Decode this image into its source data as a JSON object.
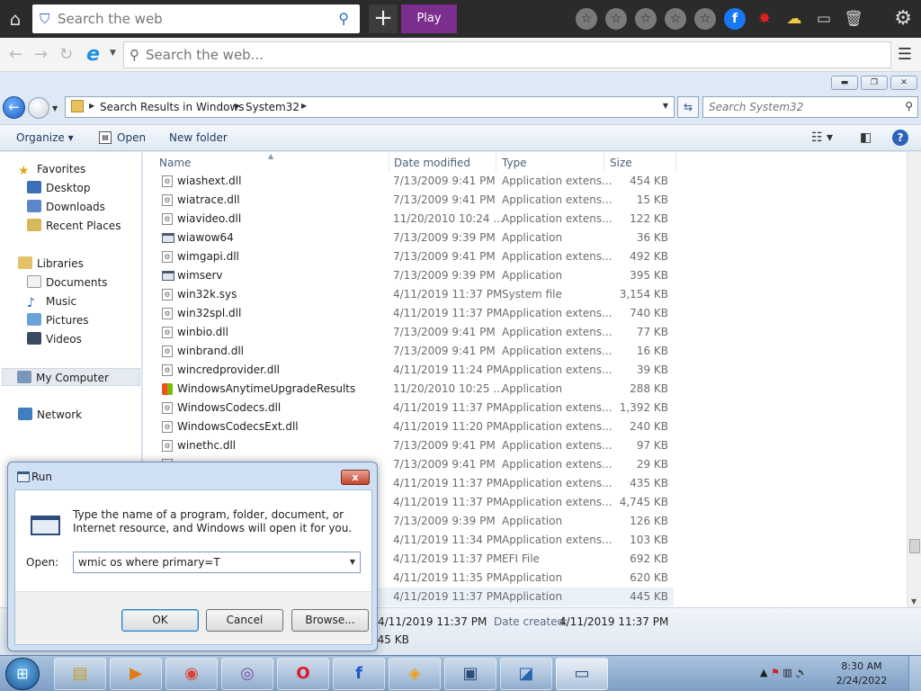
{
  "topbar": {
    "search_placeholder": "Search the web",
    "play_label": "Play",
    "plus_label": "+"
  },
  "iebar": {
    "search_placeholder": "Search the web..."
  },
  "explorer": {
    "breadcrumbs": [
      "Search Results in Windows",
      "System32"
    ],
    "search_placeholder": "Search System32",
    "commands": {
      "organize": "Organize",
      "open": "Open",
      "new_folder": "New folder"
    },
    "nav": {
      "favorites": "Favorites",
      "desktop": "Desktop",
      "downloads": "Downloads",
      "recent_places": "Recent Places",
      "libraries": "Libraries",
      "documents": "Documents",
      "music": "Music",
      "pictures": "Pictures",
      "videos": "Videos",
      "my_computer": "My Computer",
      "network": "Network"
    },
    "columns": {
      "name": "Name",
      "date": "Date modified",
      "type": "Type",
      "size": "Size"
    },
    "files": [
      {
        "name": "wiashext.dll",
        "date": "7/13/2009 9:41 PM",
        "type": "Application extens...",
        "size": "454 KB"
      },
      {
        "name": "wiatrace.dll",
        "date": "7/13/2009 9:41 PM",
        "type": "Application extens...",
        "size": "15 KB"
      },
      {
        "name": "wiavideo.dll",
        "date": "11/20/2010 10:24 ...",
        "type": "Application extens...",
        "size": "122 KB"
      },
      {
        "name": "wiawow64",
        "date": "7/13/2009 9:39 PM",
        "type": "Application",
        "size": "36 KB"
      },
      {
        "name": "wimgapi.dll",
        "date": "7/13/2009 9:41 PM",
        "type": "Application extens...",
        "size": "492 KB"
      },
      {
        "name": "wimserv",
        "date": "7/13/2009 9:39 PM",
        "type": "Application",
        "size": "395 KB"
      },
      {
        "name": "win32k.sys",
        "date": "4/11/2019 11:37 PM",
        "type": "System file",
        "size": "3,154 KB"
      },
      {
        "name": "win32spl.dll",
        "date": "4/11/2019 11:37 PM",
        "type": "Application extens...",
        "size": "740 KB"
      },
      {
        "name": "winbio.dll",
        "date": "7/13/2009 9:41 PM",
        "type": "Application extens...",
        "size": "77 KB"
      },
      {
        "name": "winbrand.dll",
        "date": "7/13/2009 9:41 PM",
        "type": "Application extens...",
        "size": "16 KB"
      },
      {
        "name": "wincredprovider.dll",
        "date": "4/11/2019 11:24 PM",
        "type": "Application extens...",
        "size": "39 KB"
      },
      {
        "name": "WindowsAnytimeUpgradeResults",
        "date": "11/20/2010 10:25 ...",
        "type": "Application",
        "size": "288 KB"
      },
      {
        "name": "WindowsCodecs.dll",
        "date": "4/11/2019 11:37 PM",
        "type": "Application extens...",
        "size": "1,392 KB"
      },
      {
        "name": "WindowsCodecsExt.dll",
        "date": "4/11/2019 11:20 PM",
        "type": "Application extens...",
        "size": "240 KB"
      },
      {
        "name": "winethc.dll",
        "date": "7/13/2009 9:41 PM",
        "type": "Application extens...",
        "size": "97 KB"
      },
      {
        "name": "",
        "date": "7/13/2009 9:41 PM",
        "type": "Application extens...",
        "size": "29 KB"
      },
      {
        "name": "",
        "date": "4/11/2019 11:37 PM",
        "type": "Application extens...",
        "size": "435 KB"
      },
      {
        "name": "",
        "date": "4/11/2019 11:37 PM",
        "type": "Application extens...",
        "size": "4,745 KB"
      },
      {
        "name": "",
        "date": "7/13/2009 9:39 PM",
        "type": "Application",
        "size": "126 KB"
      },
      {
        "name": "",
        "date": "4/11/2019 11:34 PM",
        "type": "Application extens...",
        "size": "103 KB"
      },
      {
        "name": "",
        "date": "4/11/2019 11:37 PM",
        "type": "EFI File",
        "size": "692 KB"
      },
      {
        "name": "",
        "date": "4/11/2019 11:35 PM",
        "type": "Application",
        "size": "620 KB"
      },
      {
        "name": "",
        "date": "4/11/2019 11:37 PM",
        "type": "Application",
        "size": "445 KB"
      }
    ],
    "details": {
      "modified_value": "4/11/2019 11:37 PM",
      "created_label": "Date created:",
      "created_value": "4/11/2019 11:37 PM",
      "size_value": "445 KB"
    }
  },
  "run": {
    "title": "Run",
    "close": "x",
    "message": "Type the name of a program, folder, document, or Internet resource, and Windows will open it for you.",
    "open_label": "Open:",
    "command": "wmic os where primary=T",
    "ok": "OK",
    "cancel": "Cancel",
    "browse": "Browse..."
  },
  "taskbar": {
    "time": "8:30 AM",
    "date": "2/24/2022"
  }
}
